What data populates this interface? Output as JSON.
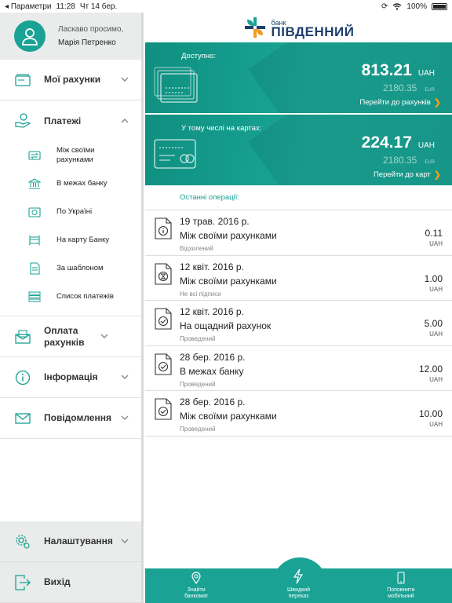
{
  "status": {
    "left_app": "Параметри",
    "time": "11:28",
    "date": "Чт 14 бер.",
    "battery": "100%",
    "battery_level": 1.0
  },
  "profile": {
    "greeting": "Ласкаво просимо,",
    "name": "Марія Петренко"
  },
  "sidebar": {
    "items": [
      {
        "label": "Мої рахунки"
      },
      {
        "label": "Платежі"
      }
    ],
    "sub_items": [
      {
        "label": "Між своїми рахунками"
      },
      {
        "label": "В межах банку"
      },
      {
        "label": "По Україні"
      },
      {
        "label": "На карту Банку"
      },
      {
        "label": "За шаблоном"
      },
      {
        "label": "Список платежів"
      }
    ],
    "items2": [
      {
        "label": "Оплата рахунків"
      },
      {
        "label": "Інформація"
      },
      {
        "label": "Повідомлення"
      }
    ],
    "bottom": [
      {
        "label": "Налаштування"
      },
      {
        "label": "Вихід"
      }
    ]
  },
  "logo": {
    "top": "банк",
    "name": "ПІВДЕННИЙ"
  },
  "cards": [
    {
      "label": "Доступно:",
      "amount": "813.21",
      "currency": "UAH",
      "secondary": "2180.35",
      "secondary_currency": "EUR",
      "link": "Перейти до рахунків"
    },
    {
      "label": "У тому числі на картах:",
      "amount": "224.17",
      "currency": "UAH",
      "secondary": "2180.35",
      "secondary_currency": "EUR",
      "link": "Перейти до карт"
    }
  ],
  "ops_title": "Останні операції:",
  "operations": [
    {
      "date": "19 трав. 2016 р.",
      "title": "Між своїми рахунками",
      "status": "Відхилений",
      "amount": "0.11",
      "currency": "UAH",
      "icon": "info-icon"
    },
    {
      "date": "12 квіт. 2016 р.",
      "title": "Між своїми рахунками",
      "status": "Не всі підписи",
      "amount": "1.00",
      "currency": "UAH",
      "icon": "hourglass-icon"
    },
    {
      "date": "12 квіт. 2016 р.",
      "title": "На ощадний рахунок",
      "status": "Проведений",
      "amount": "5.00",
      "currency": "UAH",
      "icon": "check-icon"
    },
    {
      "date": "28 бер. 2016 р.",
      "title": "В межах банку",
      "status": "Проведений",
      "amount": "12.00",
      "currency": "UAH",
      "icon": "check-icon"
    },
    {
      "date": "28 бер. 2016 р.",
      "title": "Між своїми рахунками",
      "status": "Проведений",
      "amount": "10.00",
      "currency": "UAH",
      "icon": "check-icon"
    }
  ],
  "tabs": [
    {
      "label": "Знайти банкомат",
      "icon": "location-pin-icon"
    },
    {
      "label": "Швидкий переказ",
      "icon": "lightning-icon"
    },
    {
      "label": "Поповнити мобільний",
      "icon": "mobile-phone-icon"
    }
  ],
  "colors": {
    "accent": "#1aa294",
    "orange": "#f39a1e",
    "logo_blue": "#1d3f6e"
  }
}
